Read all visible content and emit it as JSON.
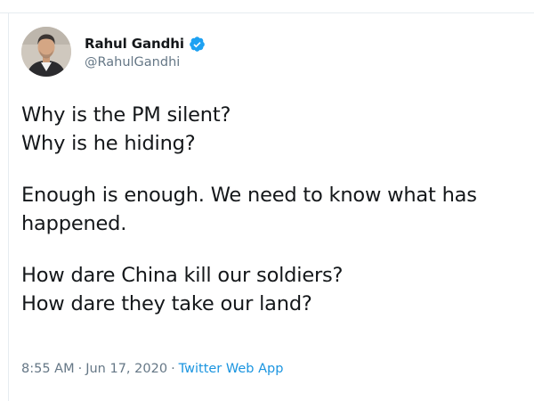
{
  "user": {
    "display_name": "Rahul Gandhi",
    "handle": "@RahulGandhi",
    "verified": true,
    "avatar_icon": "profile-photo",
    "verified_icon": "verified-badge-icon"
  },
  "tweet": {
    "lines": [
      "Why is the PM silent?",
      "Why is he hiding?",
      "Enough is enough. We need to know what has",
      "happened.",
      "How dare China kill our soldiers?",
      "How dare they take our land?"
    ]
  },
  "meta": {
    "time": "8:55 AM",
    "separator": "·",
    "date": "Jun 17, 2020",
    "source": "Twitter Web App"
  },
  "colors": {
    "text": "#14171a",
    "secondary": "#657786",
    "link": "#1b95e0",
    "verified": "#1da1f2",
    "divider": "#e6ecf0"
  }
}
